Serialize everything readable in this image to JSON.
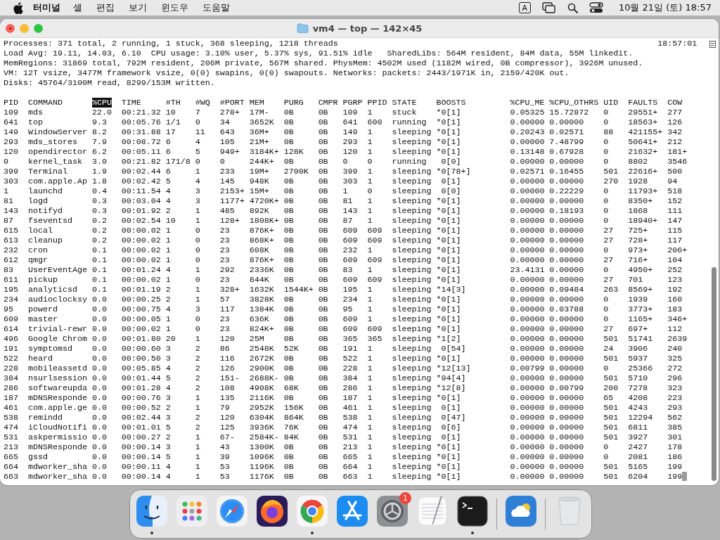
{
  "menu_bar": {
    "app": "터미널",
    "items": [
      "셸",
      "편집",
      "보기",
      "윈도우",
      "도움말"
    ],
    "input_indicator": "A",
    "clock": "10월 21일 (토) 18:57"
  },
  "window": {
    "title": "vm4 — top — 142×45"
  },
  "terminal": {
    "summary": [
      "Processes: 371 total, 2 running, 1 stuck, 368 sleeping, 1218 threads",
      "Load Avg: 19.11, 14.03, 6.10  CPU usage: 3.10% user, 5.37% sys, 91.51% idle   SharedLibs: 564M resident, 84M data, 55M linkedit.",
      "MemRegions: 31869 total, 792M resident, 206M private, 567M shared. PhysMem: 4502M used (1182M wired, 0B compressor), 3926M unused.",
      "VM: 12T vsize, 3477M framework vsize, 0(0) swapins, 0(0) swapouts. Networks: packets: 2443/1971K in, 2159/420K out.",
      "Disks: 45764/3100M read, 8299/153M written."
    ],
    "time": "18:57:01",
    "columns": [
      {
        "label": "PID",
        "sorted": false
      },
      {
        "label": "COMMAND",
        "sorted": false
      },
      {
        "label": "%CPU",
        "sorted": true
      },
      {
        "label": "TIME",
        "sorted": false
      },
      {
        "label": "#TH",
        "sorted": false
      },
      {
        "label": "#WQ",
        "sorted": false
      },
      {
        "label": "#PORT",
        "sorted": false
      },
      {
        "label": "MEM",
        "sorted": false
      },
      {
        "label": "PURG",
        "sorted": false
      },
      {
        "label": "CMPR",
        "sorted": false
      },
      {
        "label": "PGRP",
        "sorted": false
      },
      {
        "label": "PPID",
        "sorted": false
      },
      {
        "label": "STATE",
        "sorted": false
      },
      {
        "label": "BOOSTS",
        "sorted": false
      },
      {
        "label": "%CPU_ME",
        "sorted": false
      },
      {
        "label": "%CPU_OTHRS",
        "sorted": false
      },
      {
        "label": "UID",
        "sorted": false
      },
      {
        "label": "FAULTS",
        "sorted": false
      },
      {
        "label": "COW",
        "sorted": false
      }
    ],
    "rows": [
      [
        "109",
        "mds",
        "22.0",
        "00:21.32",
        "10",
        "7",
        "278+",
        "17M-",
        "0B",
        "0B",
        "109",
        "1",
        "stuck",
        "*0[1]",
        "0.05325",
        "15.72872",
        "0",
        "29551+",
        "277"
      ],
      [
        "641",
        "top",
        "9.3",
        "00:05.76",
        "1/1",
        "0",
        "34",
        "3652K",
        "0B",
        "0B",
        "641",
        "600",
        "running",
        "*0[1]",
        "0.00000",
        "0.00000",
        "0",
        "18563+",
        "126"
      ],
      [
        "149",
        "WindowServer",
        "8.2",
        "00:31.88",
        "17",
        "11",
        "643",
        "36M+",
        "0B",
        "0B",
        "149",
        "1",
        "sleeping",
        "*0[1]",
        "0.20243",
        "0.02571",
        "88",
        "421155+",
        "342"
      ],
      [
        "293",
        "mds_stores",
        "7.9",
        "00:08.72",
        "6",
        "4",
        "105",
        "21M+",
        "0B",
        "0B",
        "293",
        "1",
        "sleeping",
        "*0[1]",
        "0.00000",
        "7.48799",
        "0",
        "50641+",
        "212"
      ],
      [
        "120",
        "opendirector",
        "6.2",
        "00:05.11",
        "6",
        "5",
        "949+",
        "3184K+",
        "128K",
        "0B",
        "120",
        "1",
        "sleeping",
        "*0[1]",
        "0.13148",
        "0.67928",
        "0",
        "21632+",
        "181+"
      ],
      [
        "0",
        "kernel_task",
        "3.0",
        "00:21.82",
        "171/8",
        "0",
        "0",
        "244K+",
        "0B",
        "0B",
        "0",
        "0",
        "running",
        " 0[0]",
        "0.00000",
        "0.00000",
        "0",
        "8802",
        "3546"
      ],
      [
        "399",
        "Terminal",
        "1.9",
        "00:02.44",
        "6",
        "1",
        "233",
        "19M+",
        "2700K",
        "0B",
        "399",
        "1",
        "sleeping",
        "*0[78+]",
        "0.02571",
        "0.16455",
        "501",
        "22616+",
        "500"
      ],
      [
        "303",
        "com.apple.Ap",
        "1.8",
        "00:02.42",
        "5",
        "4",
        "145",
        "948K",
        "0B",
        "0B",
        "303",
        "1",
        "sleeping",
        " 0[1]",
        "0.00000",
        "0.00000",
        "270",
        "1928",
        "94"
      ],
      [
        "1",
        "launchd",
        "0.4",
        "00:11.54",
        "4",
        "3",
        "2153+",
        "15M+",
        "0B",
        "0B",
        "1",
        "0",
        "sleeping",
        " 0[0]",
        "0.00000",
        "0.22229",
        "0",
        "11793+",
        "518"
      ],
      [
        "81",
        "logd",
        "0.3",
        "00:03.04",
        "4",
        "3",
        "1177+",
        "4720K+",
        "0B",
        "0B",
        "81",
        "1",
        "sleeping",
        "*0[1]",
        "0.00000",
        "0.00000",
        "0",
        "8350+",
        "152"
      ],
      [
        "143",
        "notifyd",
        "0.3",
        "00:01.92",
        "2",
        "1",
        "485",
        "892K",
        "0B",
        "0B",
        "143",
        "1",
        "sleeping",
        "*0[1]",
        "0.00000",
        "0.18193",
        "0",
        "1868",
        "111"
      ],
      [
        "87",
        "fseventsd",
        "0.2",
        "00:02.54",
        "10",
        "1",
        "128+",
        "1808K+",
        "0B",
        "0B",
        "87",
        "1",
        "sleeping",
        "*0[1]",
        "0.00000",
        "0.00000",
        "0",
        "18940+",
        "147"
      ],
      [
        "615",
        "local",
        "0.2",
        "00:00.02",
        "1",
        "0",
        "23",
        "876K+",
        "0B",
        "0B",
        "609",
        "609",
        "sleeping",
        "*0[1]",
        "0.00000",
        "0.00000",
        "27",
        "725+",
        "115"
      ],
      [
        "613",
        "cleanup",
        "0.2",
        "00:00.02",
        "1",
        "0",
        "23",
        "868K+",
        "0B",
        "0B",
        "609",
        "609",
        "sleeping",
        "*0[1]",
        "0.00000",
        "0.00000",
        "27",
        "728+",
        "117"
      ],
      [
        "232",
        "cron",
        "0.1",
        "00:00.02",
        "1",
        "0",
        "23",
        "608K",
        "0B",
        "0B",
        "232",
        "1",
        "sleeping",
        "*0[1]",
        "0.00000",
        "0.00000",
        "0",
        "973+",
        "206+"
      ],
      [
        "612",
        "qmgr",
        "0.1",
        "00:00.02",
        "1",
        "0",
        "23",
        "876K+",
        "0B",
        "0B",
        "609",
        "609",
        "sleeping",
        "*0[1]",
        "0.00000",
        "0.00000",
        "27",
        "716+",
        "104"
      ],
      [
        "83",
        "UserEventAge",
        "0.1",
        "00:01.24",
        "4",
        "1",
        "292",
        "2336K",
        "0B",
        "0B",
        "83",
        "1",
        "sleeping",
        "*0[1]",
        "23.4131",
        "0.00000",
        "0",
        "4950+",
        "252"
      ],
      [
        "611",
        "pickup",
        "0.1",
        "00:00.02",
        "1",
        "0",
        "23",
        "844K",
        "0B",
        "0B",
        "609",
        "609",
        "sleeping",
        "*0[1]",
        "0.00000",
        "0.00000",
        "27",
        "701",
        "123"
      ],
      [
        "195",
        "analyticsd",
        "0.1",
        "00:01.19",
        "2",
        "1",
        "328+",
        "1632K",
        "1544K+",
        "0B",
        "195",
        "1",
        "sleeping",
        "*14[3]",
        "0.00000",
        "0.09484",
        "263",
        "8569+",
        "192"
      ],
      [
        "234",
        "audioclocksy",
        "0.0",
        "00:00.25",
        "2",
        "1",
        "57",
        "3828K",
        "0B",
        "0B",
        "234",
        "1",
        "sleeping",
        "*0[1]",
        "0.00000",
        "0.00000",
        "0",
        "1939",
        "160"
      ],
      [
        "95",
        "powerd",
        "0.0",
        "00:00.75",
        "4",
        "3",
        "117",
        "1384K",
        "0B",
        "0B",
        "95",
        "1",
        "sleeping",
        "*0[1]",
        "0.00000",
        "0.03788",
        "0",
        "3773+",
        "183"
      ],
      [
        "609",
        "master",
        "0.0",
        "00:00.05",
        "1",
        "0",
        "23",
        "636K",
        "0B",
        "0B",
        "609",
        "1",
        "sleeping",
        "*0[1]",
        "0.00000",
        "0.00000",
        "0",
        "1165+",
        "346+"
      ],
      [
        "614",
        "trivial-rewr",
        "0.0",
        "00:00.02",
        "1",
        "0",
        "23",
        "824K+",
        "0B",
        "0B",
        "609",
        "609",
        "sleeping",
        "*0[1]",
        "0.00000",
        "0.00000",
        "27",
        "697+",
        "112"
      ],
      [
        "496",
        "Google Chrom",
        "0.0",
        "00:01.80",
        "20",
        "1",
        "120",
        "25M",
        "0B",
        "0B",
        "365",
        "365",
        "sleeping",
        "*1[2]",
        "0.00000",
        "0.00000",
        "501",
        "51741",
        "2639"
      ],
      [
        "191",
        "symptomsd",
        "0.0",
        "00:00.60",
        "3",
        "2",
        "86",
        "2548K",
        "52K",
        "0B",
        "191",
        "1",
        "sleeping",
        " 0[54]",
        "0.00000",
        "0.00000",
        "24",
        "3906",
        "240"
      ],
      [
        "522",
        "heard",
        "0.0",
        "00:00.50",
        "3",
        "2",
        "116",
        "2672K",
        "0B",
        "0B",
        "522",
        "1",
        "sleeping",
        "*0[1]",
        "0.00000",
        "0.00000",
        "501",
        "5937",
        "325"
      ],
      [
        "228",
        "mobileassetd",
        "0.0",
        "00:05.85",
        "4",
        "2",
        "126",
        "2900K",
        "0B",
        "0B",
        "228",
        "1",
        "sleeping",
        "*12[13]",
        "0.00799",
        "0.00000",
        "0",
        "25366",
        "272"
      ],
      [
        "384",
        "nsurlsession",
        "0.0",
        "00:01.44",
        "5",
        "2",
        "151-",
        "2688K-",
        "0B",
        "0B",
        "384",
        "1",
        "sleeping",
        "*94[4]",
        "0.00000",
        "0.00000",
        "501",
        "5710",
        "296"
      ],
      [
        "286",
        "softwareupda",
        "0.0",
        "00:01.28",
        "4",
        "2",
        "108",
        "4908K",
        "68K",
        "0B",
        "286",
        "1",
        "sleeping",
        "*12[8]",
        "0.00000",
        "0.00799",
        "200",
        "7278",
        "323"
      ],
      [
        "187",
        "mDNSResponde",
        "0.0",
        "00:00.76",
        "3",
        "1",
        "135",
        "2116K",
        "0B",
        "0B",
        "187",
        "1",
        "sleeping",
        "*0[1]",
        "0.00000",
        "0.00000",
        "65",
        "4208",
        "223"
      ],
      [
        "461",
        "com.apple.ge",
        "0.0",
        "00:00.52",
        "2",
        "1",
        "79",
        "2952K",
        "156K",
        "0B",
        "461",
        "1",
        "sleeping",
        " 0[1]",
        "0.00000",
        "0.00000",
        "501",
        "4243",
        "293"
      ],
      [
        "538",
        "remindd",
        "0.0",
        "00:02.44",
        "3",
        "2",
        "120",
        "6304K",
        "864K",
        "0B",
        "538",
        "1",
        "sleeping",
        " 0[47]",
        "0.00000",
        "0.00000",
        "501",
        "12294",
        "562"
      ],
      [
        "474",
        "iCloudNotifi",
        "0.0",
        "00:01.01",
        "5",
        "2",
        "125",
        "3936K",
        "76K",
        "0B",
        "474",
        "1",
        "sleeping",
        " 0[6]",
        "0.00000",
        "0.00000",
        "501",
        "6811",
        "385"
      ],
      [
        "531",
        "askpermissio",
        "0.0",
        "00:00.27",
        "2",
        "1",
        "67-",
        "2584K-",
        "84K",
        "0B",
        "531",
        "1",
        "sleeping",
        " 0[1]",
        "0.00000",
        "0.00000",
        "501",
        "3927",
        "301"
      ],
      [
        "213",
        "mDNSResponde",
        "0.0",
        "00:00.14",
        "3",
        "1",
        "43",
        "1300K",
        "0B",
        "0B",
        "213",
        "1",
        "sleeping",
        "*0[1]",
        "0.00000",
        "0.00000",
        "0",
        "2427",
        "178"
      ],
      [
        "665",
        "gssd",
        "0.0",
        "00:00.14",
        "5",
        "1",
        "39",
        "1096K",
        "0B",
        "0B",
        "665",
        "1",
        "sleeping",
        "*0[1]",
        "0.00000",
        "0.00000",
        "0",
        "2081",
        "186"
      ],
      [
        "664",
        "mdworker_sha",
        "0.0",
        "00:00.11",
        "4",
        "1",
        "53",
        "1196K",
        "0B",
        "0B",
        "664",
        "1",
        "sleeping",
        "*0[1]",
        "0.00000",
        "0.00000",
        "501",
        "5165",
        "199"
      ],
      [
        "663",
        "mdworker_sha",
        "0.0",
        "00:00.14",
        "4",
        "1",
        "53",
        "1176K",
        "0B",
        "0B",
        "663",
        "1",
        "sleeping",
        "*0[1]",
        "0.00000",
        "0.00000",
        "501",
        "6204",
        "199"
      ]
    ]
  },
  "dock": {
    "items": [
      {
        "running": true
      },
      {
        "running": false
      },
      {
        "running": false
      },
      {
        "running": false
      },
      {
        "running": true
      },
      {
        "running": false
      },
      {
        "running": false,
        "badge": "1"
      },
      {
        "running": false
      },
      {
        "running": true
      },
      {
        "running": false
      },
      {
        "running": false
      }
    ]
  }
}
